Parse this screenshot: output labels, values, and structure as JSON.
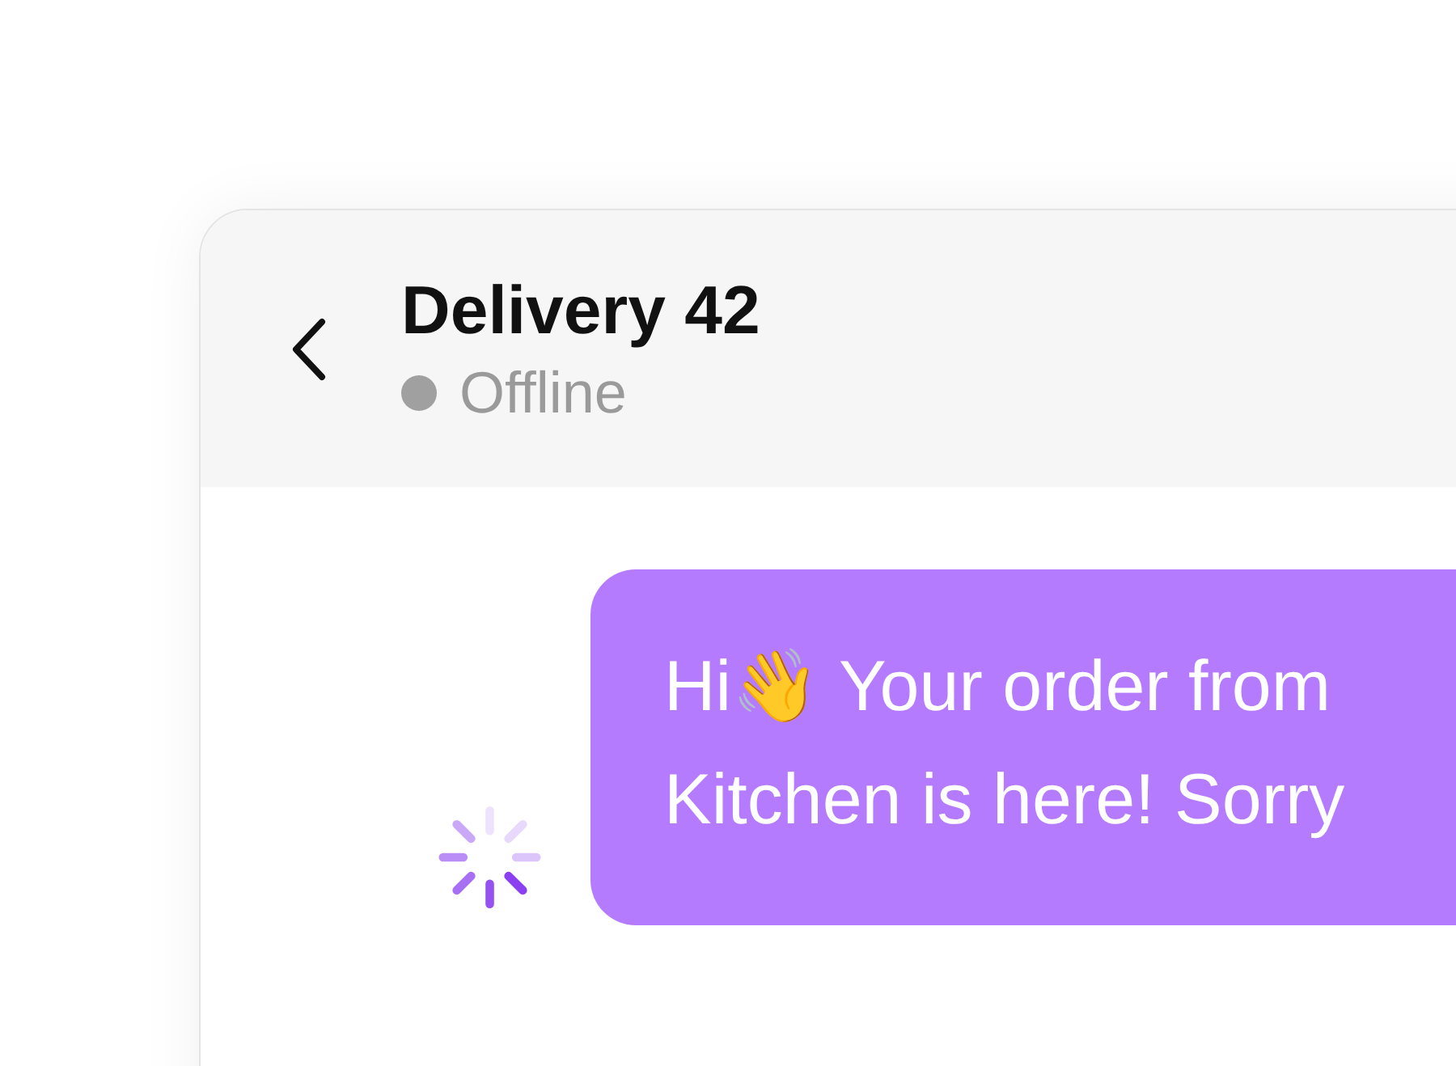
{
  "header": {
    "title": "Delivery 42",
    "status": {
      "label": "Offline",
      "online": false
    }
  },
  "messages": [
    {
      "kind": "outgoing",
      "pending": true,
      "lines": [
        "Hi👋 Your order from",
        "Kitchen is here! Sorry"
      ]
    }
  ]
}
